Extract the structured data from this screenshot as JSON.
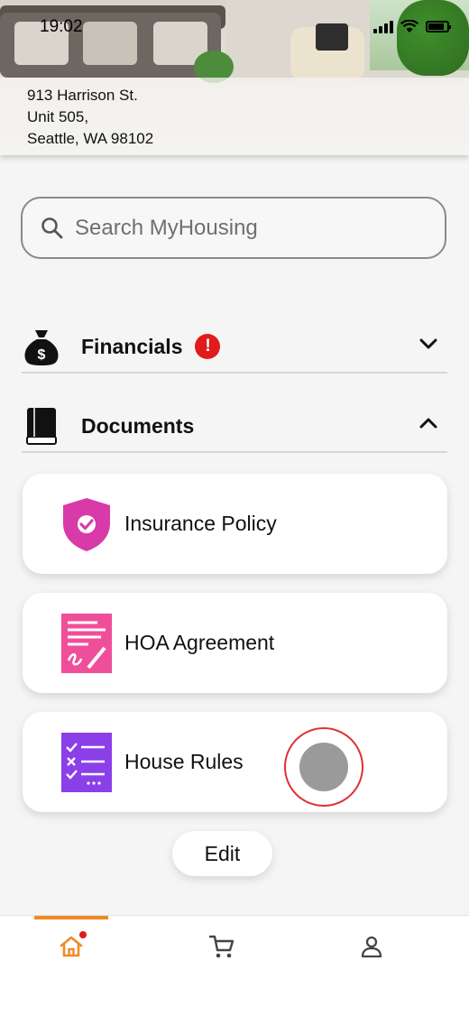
{
  "status_bar": {
    "time": "19:02"
  },
  "header": {
    "address_line1": "913 Harrison St.",
    "address_line2": "Unit 505,",
    "address_line3": "Seattle, WA 98102"
  },
  "search": {
    "placeholder": "Search MyHousing"
  },
  "sections": {
    "financials": {
      "label": "Financials",
      "alert": "!"
    },
    "documents": {
      "label": "Documents"
    }
  },
  "documents": [
    {
      "label": "Insurance Policy"
    },
    {
      "label": "HOA Agreement"
    },
    {
      "label": "House Rules"
    }
  ],
  "edit_label": "Edit",
  "colors": {
    "accent": "#f08a24",
    "alert": "#e01b1b",
    "insurance_icon": "#d93aa9",
    "hoa_icon": "#ef4f9a",
    "rules_icon": "#8b3fe8"
  }
}
